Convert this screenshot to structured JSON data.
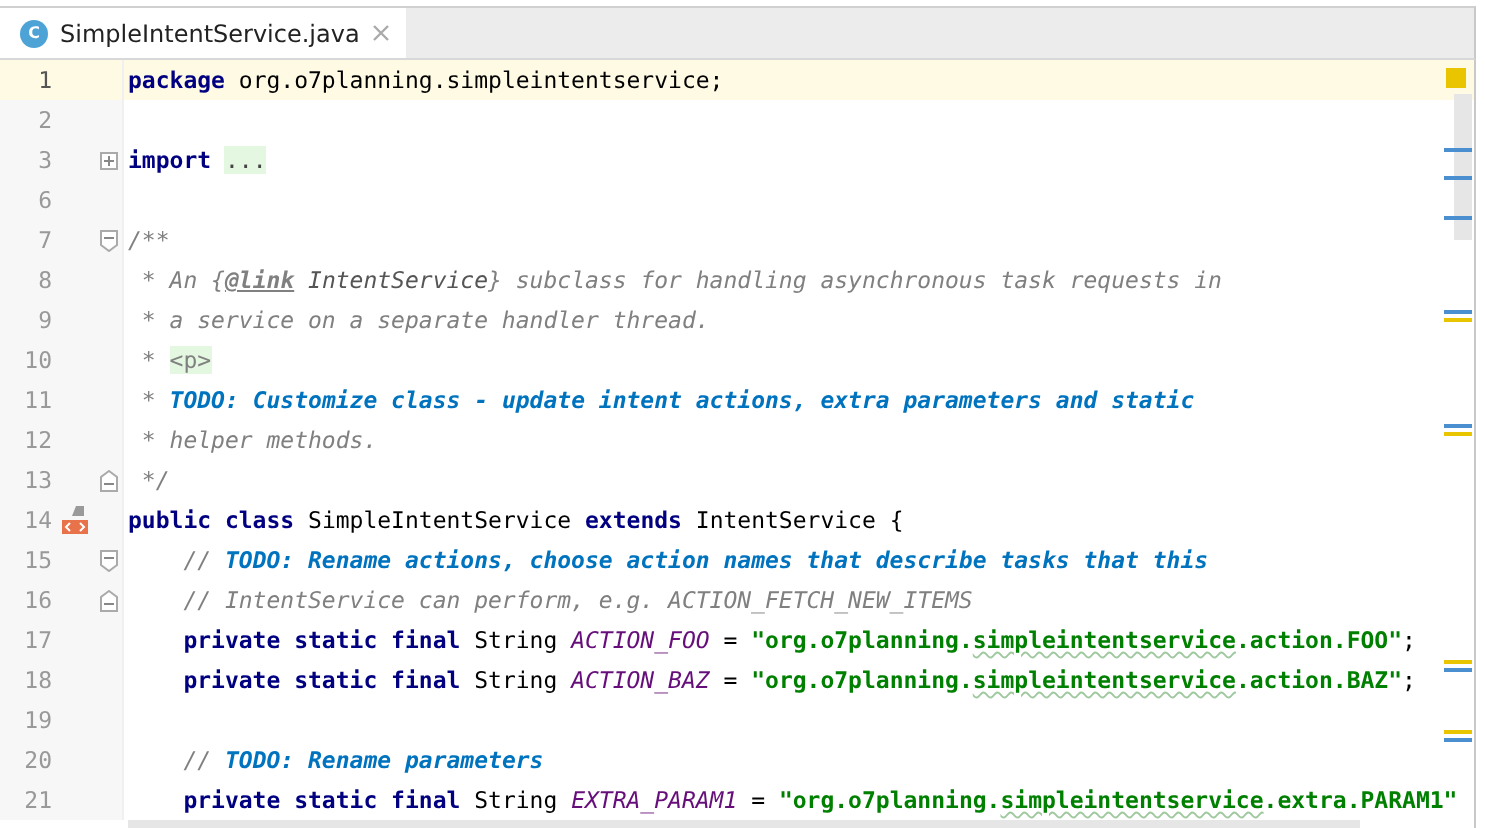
{
  "tab": {
    "title": "SimpleIntentService.java",
    "icon_letter": "C",
    "selected": true
  },
  "lines": [
    {
      "number": "1",
      "current": true,
      "tokens": [
        {
          "kind": "keyword",
          "text": "package"
        },
        {
          "kind": "plain",
          "text": " org.o7planning.simpleintentservice;"
        }
      ]
    },
    {
      "number": "2",
      "current": false
    },
    {
      "number": "3",
      "current": false,
      "fold": {
        "kind": "expand"
      },
      "tokens": [
        {
          "kind": "keyword",
          "text": "import"
        },
        {
          "kind": "folded",
          "text": "..."
        }
      ]
    },
    {
      "number": "6",
      "current": false
    },
    {
      "number": "7",
      "current": false,
      "fold": {
        "kind": "start"
      },
      "tokens": [
        {
          "kind": "doc",
          "text": "/**"
        }
      ]
    },
    {
      "number": "8",
      "current": false,
      "tokens": [
        {
          "kind": "doc",
          "text": " * An {"
        },
        {
          "kind": "link",
          "text": "@link"
        },
        {
          "kind": "docref",
          "text": " IntentService"
        },
        {
          "kind": "doc",
          "text": "} subclass for handling asynchronous task requests in"
        }
      ]
    },
    {
      "number": "9",
      "current": false,
      "tokens": [
        {
          "kind": "doc",
          "text": " * a service on a separate handler thread."
        }
      ]
    },
    {
      "number": "10",
      "current": false,
      "tokens": [
        {
          "kind": "doc",
          "text": " * "
        },
        {
          "kind": "tag",
          "text": "<p>"
        }
      ]
    },
    {
      "number": "11",
      "current": false,
      "tokens": [
        {
          "kind": "doc",
          "text": " * "
        },
        {
          "kind": "todo",
          "text": "TODO: Customize class - update intent actions, extra parameters and static"
        }
      ]
    },
    {
      "number": "12",
      "current": false,
      "tokens": [
        {
          "kind": "doc",
          "text": " * helper methods."
        }
      ]
    },
    {
      "number": "13",
      "current": false,
      "fold": {
        "kind": "end"
      },
      "tokens": [
        {
          "kind": "doc",
          "text": " */"
        }
      ]
    },
    {
      "number": "14",
      "current": false,
      "gutter_icon": {
        "kind": "brackets"
      },
      "tokens": [
        {
          "kind": "keyword",
          "text": "public class"
        },
        {
          "kind": "plain",
          "text": " SimpleIntentService "
        },
        {
          "kind": "keyword",
          "text": "extends"
        },
        {
          "kind": "plain",
          "text": " IntentService {"
        }
      ]
    },
    {
      "number": "15",
      "current": false,
      "fold": {
        "kind": "start"
      },
      "tokens": [
        {
          "kind": "comment",
          "text": "    // "
        },
        {
          "kind": "todo",
          "text": "TODO: Rename actions, choose action names that describe tasks that this"
        }
      ]
    },
    {
      "number": "16",
      "current": false,
      "fold": {
        "kind": "end"
      },
      "tokens": [
        {
          "kind": "comment",
          "text": "    // IntentService can perform, e.g. ACTION_FETCH_NEW_ITEMS"
        }
      ]
    },
    {
      "number": "17",
      "current": false,
      "tokens": [
        {
          "kind": "keyword",
          "text": "    private static final"
        },
        {
          "kind": "plain",
          "text": " String "
        },
        {
          "kind": "const",
          "text": "ACTION_FOO"
        },
        {
          "kind": "plain",
          "text": " = "
        },
        {
          "kind": "string",
          "text": "\"org.o7planning."
        },
        {
          "kind": "typo",
          "text": "simpleintentservice"
        },
        {
          "kind": "string",
          "text": ".action.FOO\""
        },
        {
          "kind": "plain",
          "text": ";"
        }
      ]
    },
    {
      "number": "18",
      "current": false,
      "tokens": [
        {
          "kind": "keyword",
          "text": "    private static final"
        },
        {
          "kind": "plain",
          "text": " String "
        },
        {
          "kind": "const",
          "text": "ACTION_BAZ"
        },
        {
          "kind": "plain",
          "text": " = "
        },
        {
          "kind": "string",
          "text": "\"org.o7planning."
        },
        {
          "kind": "typo",
          "text": "simpleintentservice"
        },
        {
          "kind": "string",
          "text": ".action.BAZ\""
        },
        {
          "kind": "plain",
          "text": ";"
        }
      ]
    },
    {
      "number": "19",
      "current": false
    },
    {
      "number": "20",
      "current": false,
      "tokens": [
        {
          "kind": "comment",
          "text": "    // "
        },
        {
          "kind": "todo",
          "text": "TODO: Rename parameters"
        }
      ]
    },
    {
      "number": "21",
      "current": false,
      "tokens": [
        {
          "kind": "keyword",
          "text": "    private static final"
        },
        {
          "kind": "plain",
          "text": " String "
        },
        {
          "kind": "const",
          "text": "EXTRA_PARAM1"
        },
        {
          "kind": "plain",
          "text": " = "
        },
        {
          "kind": "string",
          "text": "\"org.o7planning."
        },
        {
          "kind": "typo",
          "text": "simpleintentservice"
        },
        {
          "kind": "string",
          "text": ".extra.PARAM1\""
        }
      ]
    }
  ]
}
